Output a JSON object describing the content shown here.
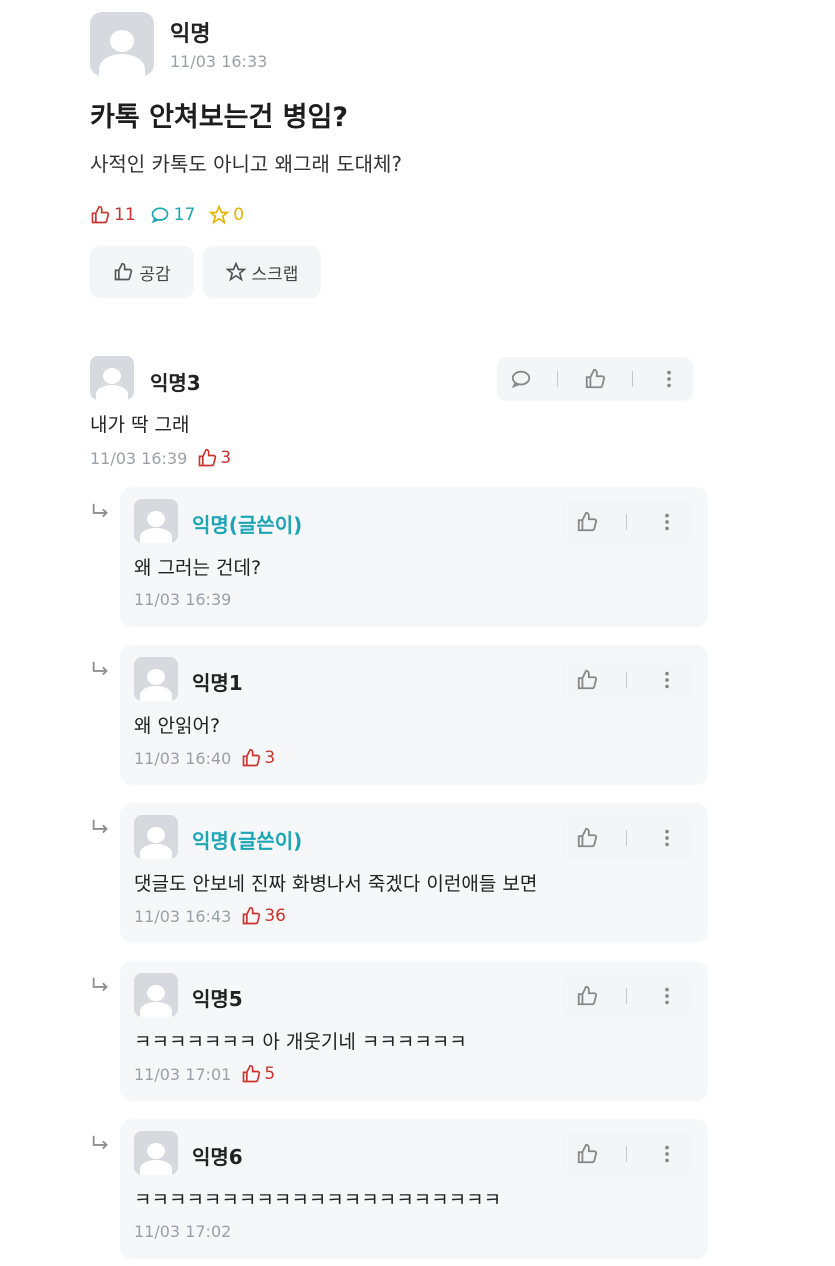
{
  "post": {
    "author": "익명",
    "time": "11/03 16:33",
    "title": "카톡 안쳐보는건 병임?",
    "body": "사적인 카톡도 아니고 왜그래 도대체?",
    "stats": {
      "likes": "11",
      "comments": "17",
      "scraps": "0"
    },
    "buttons": {
      "like_label": "공감",
      "scrap_label": "스크랩"
    }
  },
  "comments": [
    {
      "author": "익명3",
      "text": "내가 딱 그래",
      "time": "11/03 16:39",
      "likes": "3"
    }
  ],
  "replies": [
    {
      "author": "익명(글쓴이)",
      "is_writer": true,
      "text": "왜 그러는 건데?",
      "time": "11/03 16:39",
      "likes": ""
    },
    {
      "author": "익명1",
      "is_writer": false,
      "text": "왜 안읽어?",
      "time": "11/03 16:40",
      "likes": "3"
    },
    {
      "author": "익명(글쓴이)",
      "is_writer": true,
      "text": "댓글도 안보네 진짜 화병나서 죽겠다 이런애들 보면",
      "time": "11/03 16:43",
      "likes": "36"
    },
    {
      "author": "익명5",
      "is_writer": false,
      "text": "ㅋㅋㅋㅋㅋㅋㅋ 아 개웃기네 ㅋㅋㅋㅋㅋㅋ",
      "time": "11/03 17:01",
      "likes": "5"
    },
    {
      "author": "익명6",
      "is_writer": false,
      "text": "ㅋㅋㅋㅋㅋㅋㅋㅋㅋㅋㅋㅋㅋㅋㅋㅋㅋㅋㅋㅋㅋ",
      "time": "11/03 17:02",
      "likes": ""
    }
  ],
  "colors": {
    "like": "#c9342f",
    "comment": "#1ca6b5",
    "scrap": "#e2b400",
    "writer": "#1ca6b5"
  },
  "icons": {
    "like": "thumbs-up-icon",
    "comment": "speech-bubble-icon",
    "scrap": "star-icon",
    "more": "more-vertical-icon",
    "reply": "reply-arrow-icon"
  }
}
